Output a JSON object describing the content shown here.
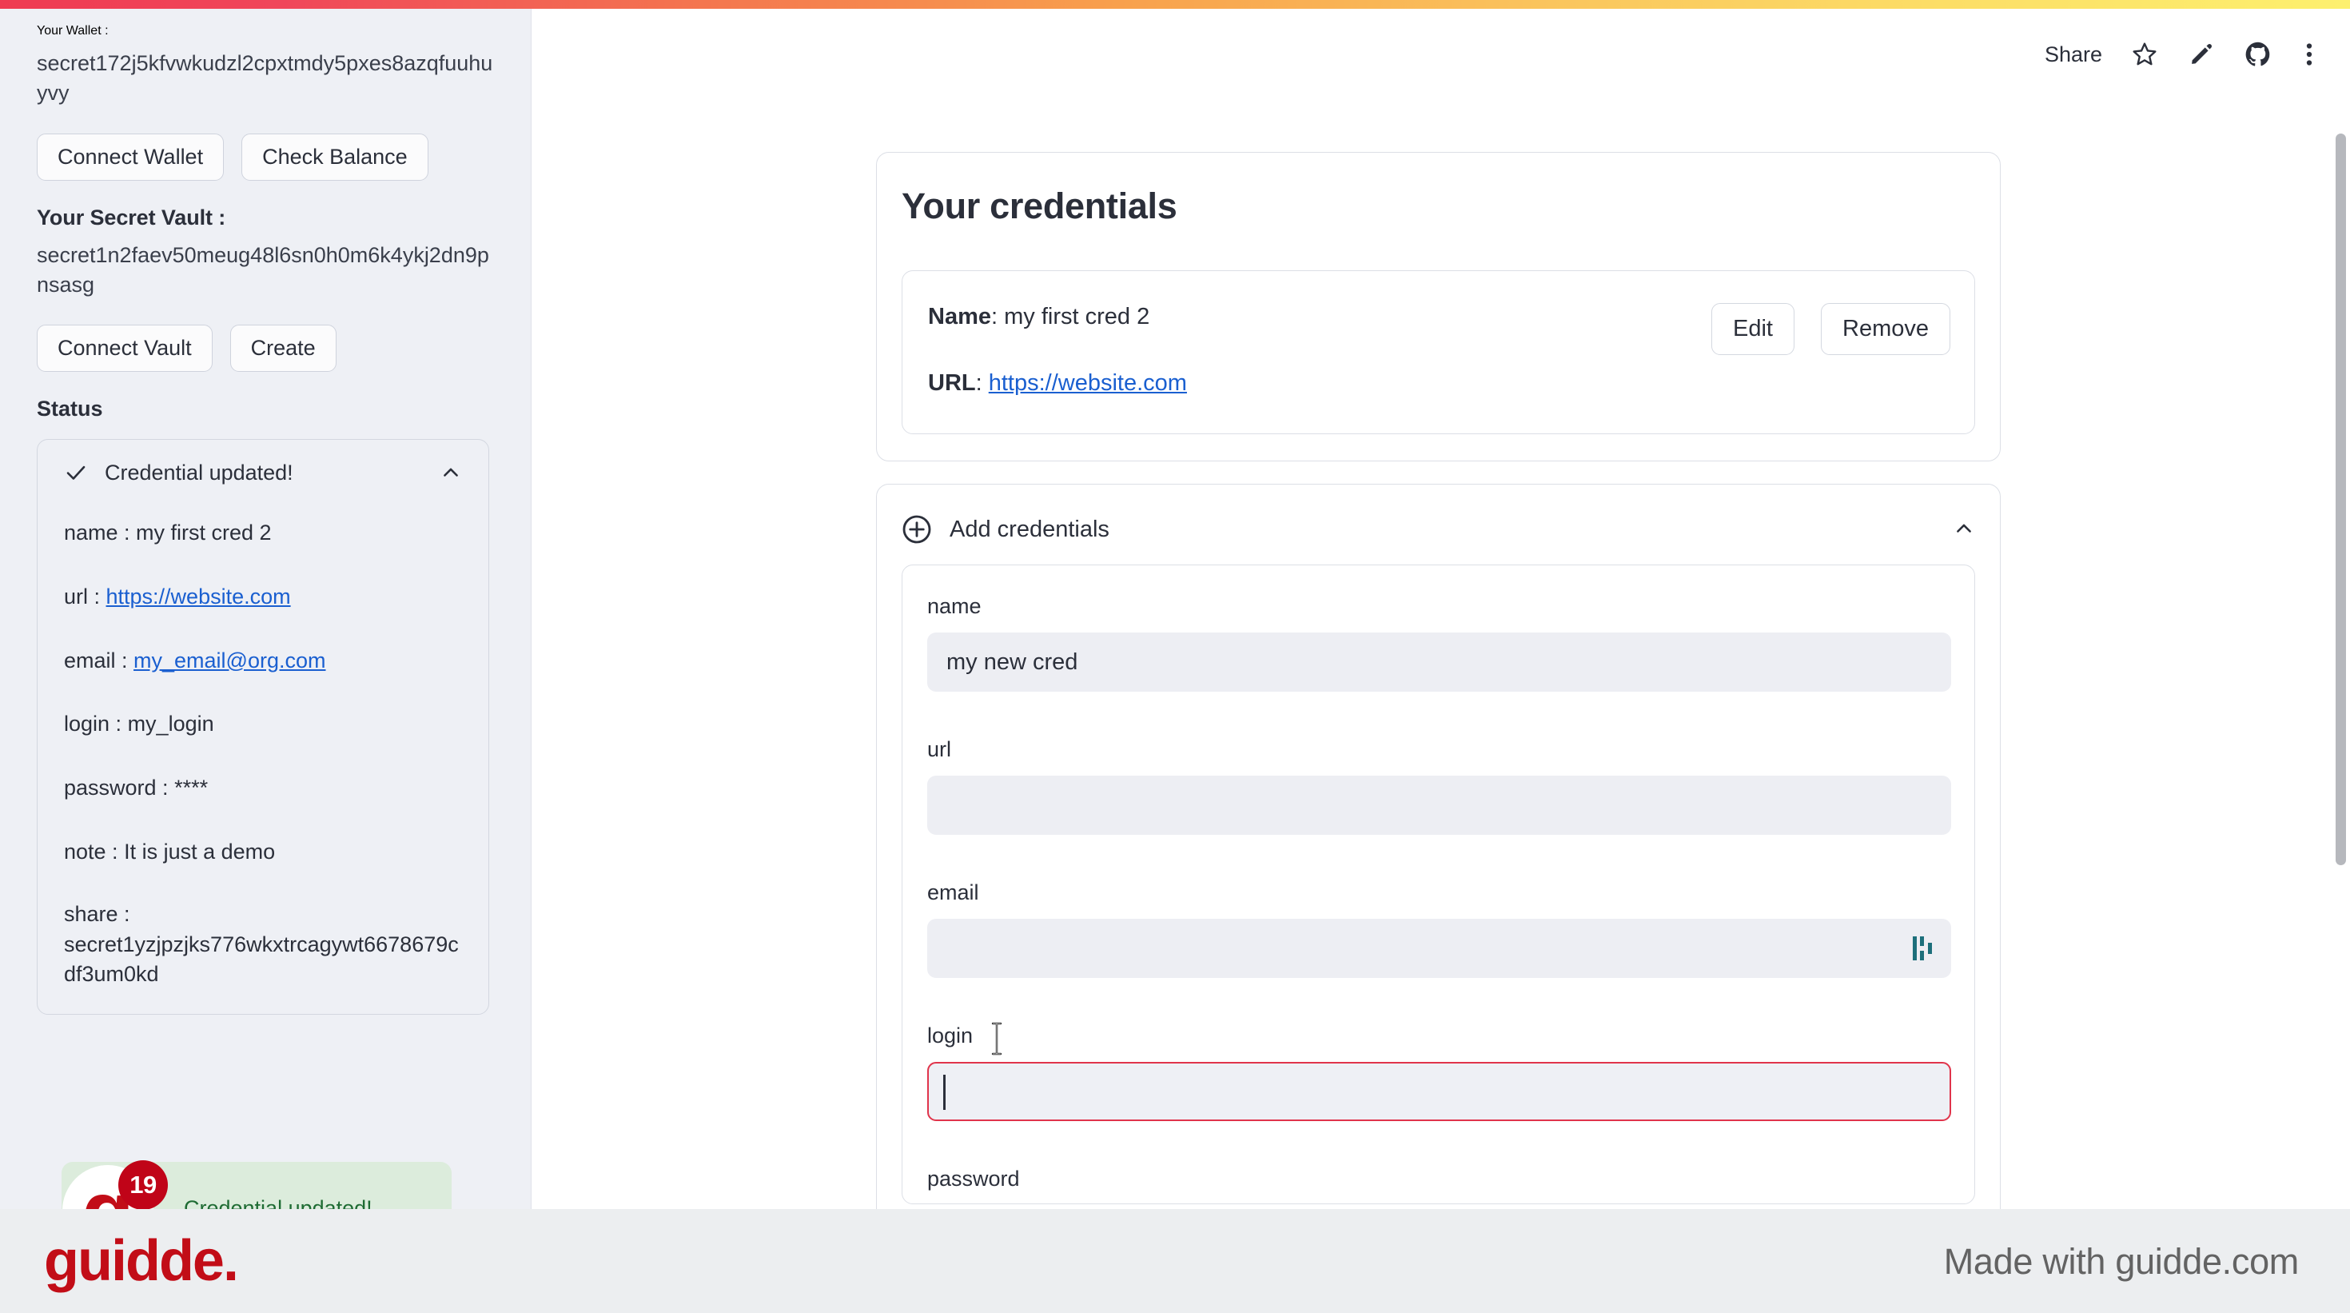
{
  "topbar": {
    "share_label": "Share",
    "icons": [
      "star-icon",
      "pencil-icon",
      "github-icon",
      "kebab-menu-icon"
    ]
  },
  "sidebar": {
    "wallet_heading": "Your Wallet :",
    "wallet_address": "secret172j5kfvwkudzl2cpxtmdy5pxes8azqfuuhuyvy",
    "wallet_buttons": [
      "Connect Wallet",
      "Check Balance"
    ],
    "vault_heading": "Your Secret Vault :",
    "vault_address": "secret1n2faev50meug48l6sn0h0m6k4ykj2dn9pnsasg",
    "vault_buttons": [
      "Connect Vault",
      "Create"
    ],
    "status_label": "Status",
    "status_card": {
      "title": "Credential updated!",
      "rows": [
        {
          "key": "name : ",
          "value": "my first cred 2",
          "link": false
        },
        {
          "key": "url : ",
          "value": "https://website.com",
          "link": true
        },
        {
          "key": "email : ",
          "value": "my_email@org.com",
          "link": true
        },
        {
          "key": "login : ",
          "value": "my_login",
          "link": false
        },
        {
          "key": "password : ",
          "value": "****",
          "link": false
        },
        {
          "key": "note : ",
          "value": "It is just a demo",
          "link": false
        }
      ],
      "share_key": "share :",
      "share_value": "secret1yzjpzjks776wkxtrcagywt6678679cdf3um0kd"
    },
    "toast": {
      "text": "Credential updated!",
      "badge_count": "19",
      "avatar_letter": "g"
    }
  },
  "main": {
    "credentials_card": {
      "title": "Your credentials",
      "name_key": "Name",
      "name_value": "my first cred 2",
      "url_key": "URL",
      "url_value": "https://website.com",
      "edit_label": "Edit",
      "remove_label": "Remove"
    },
    "add_card": {
      "header_label": "Add credentials",
      "fields": [
        {
          "label": "name",
          "value": "my new cred",
          "placeholder": "",
          "focused": false,
          "icons": []
        },
        {
          "label": "url",
          "value": "",
          "placeholder": "",
          "focused": false,
          "icons": []
        },
        {
          "label": "email",
          "value": "",
          "placeholder": "",
          "focused": false,
          "icons": [
            "password-manager-icon"
          ]
        },
        {
          "label": "login",
          "value": "",
          "placeholder": "",
          "focused": true,
          "icons": []
        },
        {
          "label": "password",
          "value": "",
          "placeholder": "",
          "focused": false,
          "icons": [
            "password-manager-icon",
            "eye-icon"
          ]
        }
      ]
    }
  },
  "footer": {
    "logo_text": "guidde.",
    "made_with": "Made with guidde.com"
  },
  "colors": {
    "accent_red": "#e0344b",
    "link_blue": "#1a5fd0",
    "brand_red": "#c20d17",
    "toast_green_bg": "#dcecdc",
    "toast_green_text": "#1e6b33",
    "teal_icon": "#1d6f7b",
    "sidebar_bg": "#eef0f5",
    "input_bg": "#edeef3"
  }
}
